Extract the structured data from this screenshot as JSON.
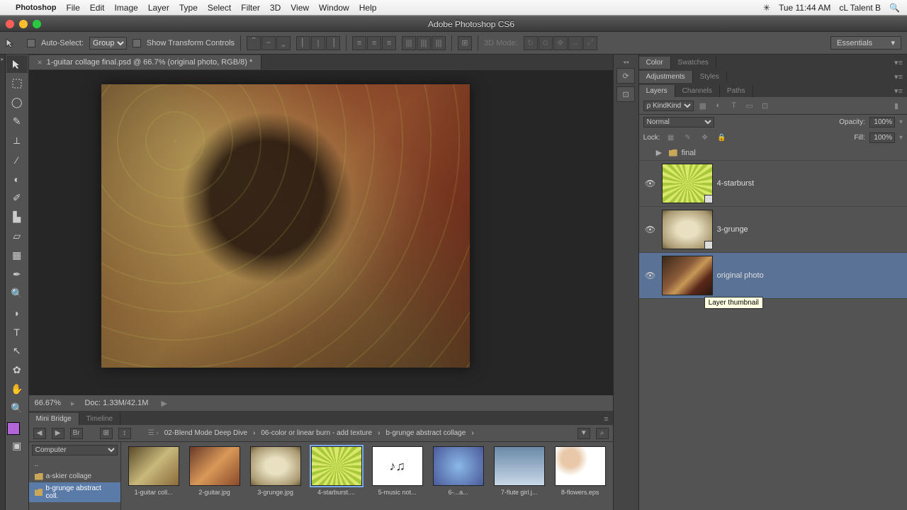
{
  "menubar": {
    "app": "Photoshop",
    "items": [
      "File",
      "Edit",
      "Image",
      "Layer",
      "Type",
      "Select",
      "Filter",
      "3D",
      "View",
      "Window",
      "Help"
    ],
    "time": "Tue 11:44 AM",
    "user": "cL Talent B"
  },
  "window": {
    "title": "Adobe Photoshop CS6"
  },
  "options": {
    "auto_select": "Auto-Select:",
    "group": "Group",
    "show_transform": "Show Transform Controls",
    "mode3d": "3D Mode:",
    "workspace": "Essentials"
  },
  "document": {
    "tab": "1-guitar collage final.psd @ 66.7% (original photo, RGB/8) *",
    "zoom": "66.67%",
    "doc_size": "Doc: 1.33M/42.1M"
  },
  "mini_bridge": {
    "tabs": [
      "Mini Bridge",
      "Timeline"
    ],
    "breadcrumbs": [
      "02-Blend Mode Deep Dive",
      "06-color or linear burn - add texture",
      "b-grunge abstract collage"
    ],
    "location": "Computer",
    "dotdot": "..",
    "folders": [
      {
        "name": "a-skier collage",
        "selected": false
      },
      {
        "name": "b-grunge abstract coll.",
        "selected": true
      }
    ],
    "thumbs": [
      {
        "label": "1-guitar coll...",
        "cls": "tx-guitar1"
      },
      {
        "label": "2-guitar.jpg",
        "cls": "tx-guitar2"
      },
      {
        "label": "3-grunge.jpg",
        "cls": "tx-grunge"
      },
      {
        "label": "4-starburst....",
        "cls": "tx-starburst",
        "selected": true
      },
      {
        "label": "5-music not...",
        "cls": "tx-music"
      },
      {
        "label": "6-...a...",
        "cls": "tx-lesson"
      },
      {
        "label": "7-flute girl.j...",
        "cls": "tx-flute"
      },
      {
        "label": "8-flowers.eps",
        "cls": "tx-flowers"
      }
    ]
  },
  "panels": {
    "group1": [
      "Color",
      "Swatches"
    ],
    "group2": [
      "Adjustments",
      "Styles"
    ],
    "group3": [
      "Layers",
      "Channels",
      "Paths"
    ]
  },
  "layers": {
    "kind": "Kind",
    "blend_mode": "Normal",
    "opacity_label": "Opacity:",
    "opacity": "100%",
    "lock_label": "Lock:",
    "fill_label": "Fill:",
    "fill": "100%",
    "group_name": "final",
    "items": [
      {
        "name": "4-starburst",
        "thumb": "tx-starburst",
        "smart": true
      },
      {
        "name": "3-grunge",
        "thumb": "tx-grunge",
        "smart": true
      },
      {
        "name": "original photo",
        "thumb": "tx-photo",
        "selected": true
      }
    ],
    "tooltip": "Layer thumbnail"
  }
}
